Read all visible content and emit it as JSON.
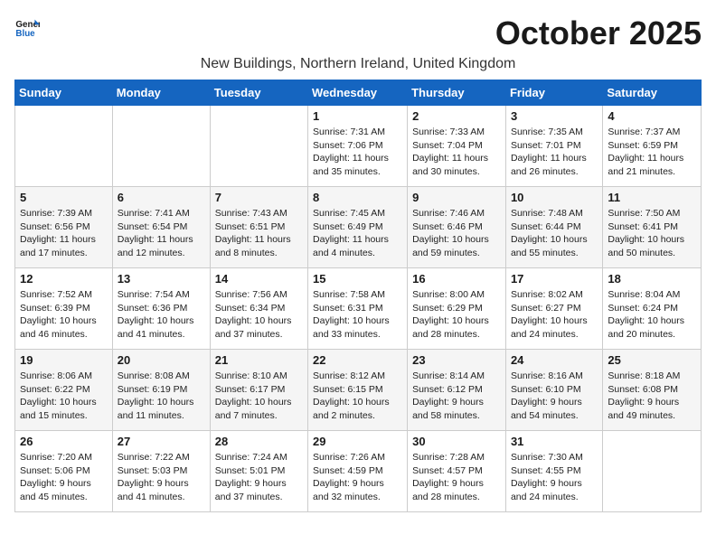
{
  "header": {
    "logo_line1": "General",
    "logo_line2": "Blue",
    "month": "October 2025",
    "location": "New Buildings, Northern Ireland, United Kingdom"
  },
  "weekdays": [
    "Sunday",
    "Monday",
    "Tuesday",
    "Wednesday",
    "Thursday",
    "Friday",
    "Saturday"
  ],
  "weeks": [
    [
      {
        "day": "",
        "sunrise": "",
        "sunset": "",
        "daylight": ""
      },
      {
        "day": "",
        "sunrise": "",
        "sunset": "",
        "daylight": ""
      },
      {
        "day": "",
        "sunrise": "",
        "sunset": "",
        "daylight": ""
      },
      {
        "day": "1",
        "sunrise": "Sunrise: 7:31 AM",
        "sunset": "Sunset: 7:06 PM",
        "daylight": "Daylight: 11 hours and 35 minutes."
      },
      {
        "day": "2",
        "sunrise": "Sunrise: 7:33 AM",
        "sunset": "Sunset: 7:04 PM",
        "daylight": "Daylight: 11 hours and 30 minutes."
      },
      {
        "day": "3",
        "sunrise": "Sunrise: 7:35 AM",
        "sunset": "Sunset: 7:01 PM",
        "daylight": "Daylight: 11 hours and 26 minutes."
      },
      {
        "day": "4",
        "sunrise": "Sunrise: 7:37 AM",
        "sunset": "Sunset: 6:59 PM",
        "daylight": "Daylight: 11 hours and 21 minutes."
      }
    ],
    [
      {
        "day": "5",
        "sunrise": "Sunrise: 7:39 AM",
        "sunset": "Sunset: 6:56 PM",
        "daylight": "Daylight: 11 hours and 17 minutes."
      },
      {
        "day": "6",
        "sunrise": "Sunrise: 7:41 AM",
        "sunset": "Sunset: 6:54 PM",
        "daylight": "Daylight: 11 hours and 12 minutes."
      },
      {
        "day": "7",
        "sunrise": "Sunrise: 7:43 AM",
        "sunset": "Sunset: 6:51 PM",
        "daylight": "Daylight: 11 hours and 8 minutes."
      },
      {
        "day": "8",
        "sunrise": "Sunrise: 7:45 AM",
        "sunset": "Sunset: 6:49 PM",
        "daylight": "Daylight: 11 hours and 4 minutes."
      },
      {
        "day": "9",
        "sunrise": "Sunrise: 7:46 AM",
        "sunset": "Sunset: 6:46 PM",
        "daylight": "Daylight: 10 hours and 59 minutes."
      },
      {
        "day": "10",
        "sunrise": "Sunrise: 7:48 AM",
        "sunset": "Sunset: 6:44 PM",
        "daylight": "Daylight: 10 hours and 55 minutes."
      },
      {
        "day": "11",
        "sunrise": "Sunrise: 7:50 AM",
        "sunset": "Sunset: 6:41 PM",
        "daylight": "Daylight: 10 hours and 50 minutes."
      }
    ],
    [
      {
        "day": "12",
        "sunrise": "Sunrise: 7:52 AM",
        "sunset": "Sunset: 6:39 PM",
        "daylight": "Daylight: 10 hours and 46 minutes."
      },
      {
        "day": "13",
        "sunrise": "Sunrise: 7:54 AM",
        "sunset": "Sunset: 6:36 PM",
        "daylight": "Daylight: 10 hours and 41 minutes."
      },
      {
        "day": "14",
        "sunrise": "Sunrise: 7:56 AM",
        "sunset": "Sunset: 6:34 PM",
        "daylight": "Daylight: 10 hours and 37 minutes."
      },
      {
        "day": "15",
        "sunrise": "Sunrise: 7:58 AM",
        "sunset": "Sunset: 6:31 PM",
        "daylight": "Daylight: 10 hours and 33 minutes."
      },
      {
        "day": "16",
        "sunrise": "Sunrise: 8:00 AM",
        "sunset": "Sunset: 6:29 PM",
        "daylight": "Daylight: 10 hours and 28 minutes."
      },
      {
        "day": "17",
        "sunrise": "Sunrise: 8:02 AM",
        "sunset": "Sunset: 6:27 PM",
        "daylight": "Daylight: 10 hours and 24 minutes."
      },
      {
        "day": "18",
        "sunrise": "Sunrise: 8:04 AM",
        "sunset": "Sunset: 6:24 PM",
        "daylight": "Daylight: 10 hours and 20 minutes."
      }
    ],
    [
      {
        "day": "19",
        "sunrise": "Sunrise: 8:06 AM",
        "sunset": "Sunset: 6:22 PM",
        "daylight": "Daylight: 10 hours and 15 minutes."
      },
      {
        "day": "20",
        "sunrise": "Sunrise: 8:08 AM",
        "sunset": "Sunset: 6:19 PM",
        "daylight": "Daylight: 10 hours and 11 minutes."
      },
      {
        "day": "21",
        "sunrise": "Sunrise: 8:10 AM",
        "sunset": "Sunset: 6:17 PM",
        "daylight": "Daylight: 10 hours and 7 minutes."
      },
      {
        "day": "22",
        "sunrise": "Sunrise: 8:12 AM",
        "sunset": "Sunset: 6:15 PM",
        "daylight": "Daylight: 10 hours and 2 minutes."
      },
      {
        "day": "23",
        "sunrise": "Sunrise: 8:14 AM",
        "sunset": "Sunset: 6:12 PM",
        "daylight": "Daylight: 9 hours and 58 minutes."
      },
      {
        "day": "24",
        "sunrise": "Sunrise: 8:16 AM",
        "sunset": "Sunset: 6:10 PM",
        "daylight": "Daylight: 9 hours and 54 minutes."
      },
      {
        "day": "25",
        "sunrise": "Sunrise: 8:18 AM",
        "sunset": "Sunset: 6:08 PM",
        "daylight": "Daylight: 9 hours and 49 minutes."
      }
    ],
    [
      {
        "day": "26",
        "sunrise": "Sunrise: 7:20 AM",
        "sunset": "Sunset: 5:06 PM",
        "daylight": "Daylight: 9 hours and 45 minutes."
      },
      {
        "day": "27",
        "sunrise": "Sunrise: 7:22 AM",
        "sunset": "Sunset: 5:03 PM",
        "daylight": "Daylight: 9 hours and 41 minutes."
      },
      {
        "day": "28",
        "sunrise": "Sunrise: 7:24 AM",
        "sunset": "Sunset: 5:01 PM",
        "daylight": "Daylight: 9 hours and 37 minutes."
      },
      {
        "day": "29",
        "sunrise": "Sunrise: 7:26 AM",
        "sunset": "Sunset: 4:59 PM",
        "daylight": "Daylight: 9 hours and 32 minutes."
      },
      {
        "day": "30",
        "sunrise": "Sunrise: 7:28 AM",
        "sunset": "Sunset: 4:57 PM",
        "daylight": "Daylight: 9 hours and 28 minutes."
      },
      {
        "day": "31",
        "sunrise": "Sunrise: 7:30 AM",
        "sunset": "Sunset: 4:55 PM",
        "daylight": "Daylight: 9 hours and 24 minutes."
      },
      {
        "day": "",
        "sunrise": "",
        "sunset": "",
        "daylight": ""
      }
    ]
  ]
}
